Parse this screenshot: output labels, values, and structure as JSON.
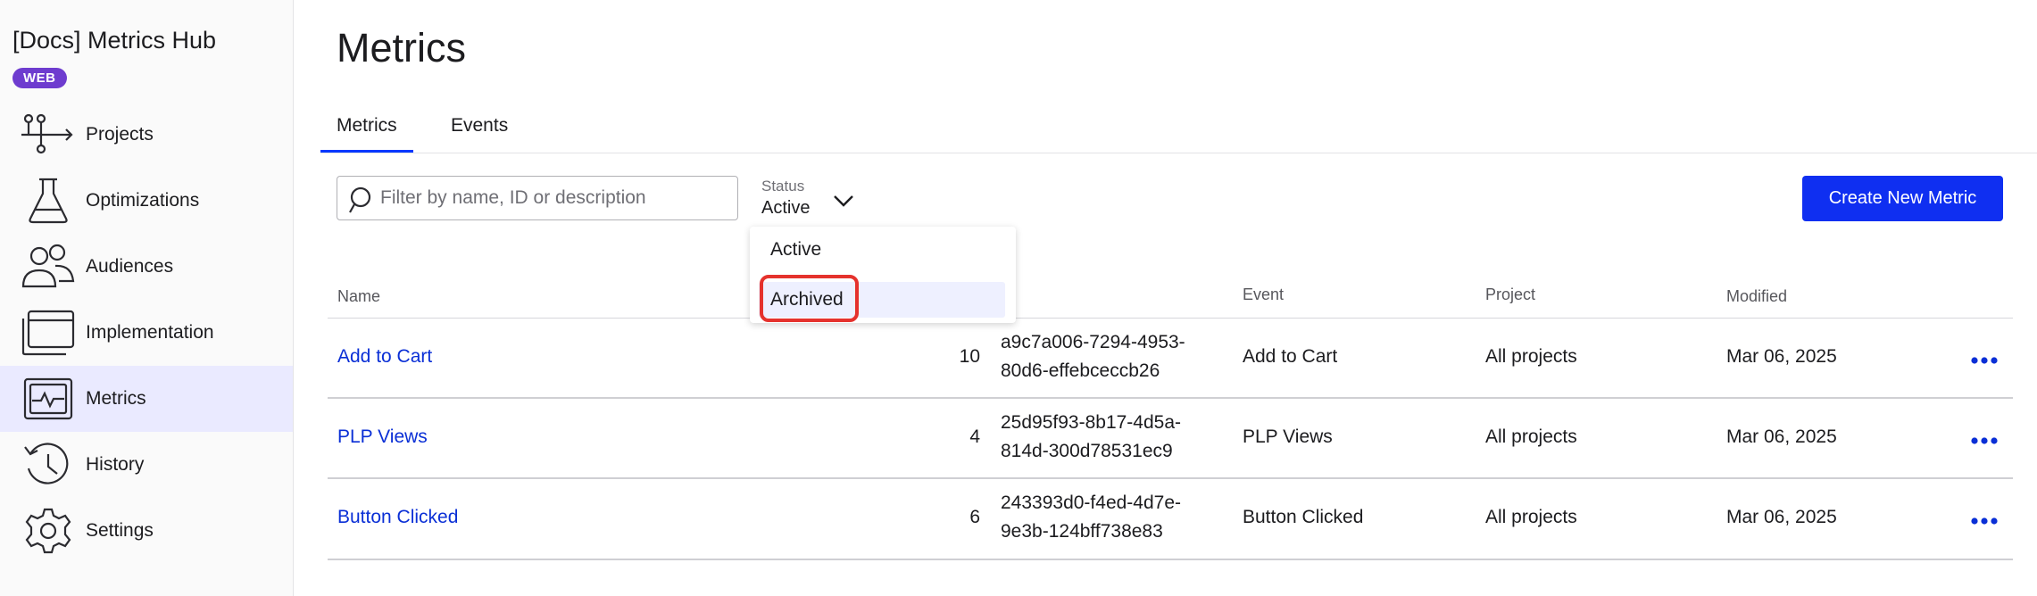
{
  "sidebar": {
    "app_title": "[Docs] Metrics Hub",
    "badge": "WEB",
    "items": [
      {
        "label": "Projects",
        "icon": "projects-icon"
      },
      {
        "label": "Optimizations",
        "icon": "flask-icon"
      },
      {
        "label": "Audiences",
        "icon": "users-icon"
      },
      {
        "label": "Implementation",
        "icon": "window-icon"
      },
      {
        "label": "Metrics",
        "icon": "pulse-chart-icon",
        "active": true
      },
      {
        "label": "History",
        "icon": "history-icon"
      },
      {
        "label": "Settings",
        "icon": "gear-icon"
      }
    ]
  },
  "main": {
    "title": "Metrics",
    "tabs": [
      {
        "label": "Metrics",
        "active": true
      },
      {
        "label": "Events",
        "active": false
      }
    ],
    "search": {
      "placeholder": "Filter by name, ID or description",
      "value": ""
    },
    "status": {
      "label": "Status",
      "value": "Active",
      "options": [
        "Active",
        "Archived"
      ],
      "highlighted": "Archived"
    },
    "create_button": "Create New Metric",
    "colors": {
      "accent": "#0f2ff1",
      "link": "#0a2fd6",
      "highlight_ring": "#e5322d",
      "active_nav": "#eaeaff"
    }
  },
  "table": {
    "headers": {
      "name": "Name",
      "event": "Event",
      "project": "Project",
      "modified": "Modified"
    },
    "rows": [
      {
        "name": "Add to Cart",
        "count": "10",
        "id_line1": "a9c7a006-7294-4953-",
        "id_line2": "80d6-effebceccb26",
        "event": "Add to Cart",
        "project": "All projects",
        "modified": "Mar 06, 2025"
      },
      {
        "name": "PLP Views",
        "count": "4",
        "id_line1": "25d95f93-8b17-4d5a-",
        "id_line2": "814d-300d78531ec9",
        "event": "PLP Views",
        "project": "All projects",
        "modified": "Mar 06, 2025"
      },
      {
        "name": "Button Clicked",
        "count": "6",
        "id_line1": "243393d0-f4ed-4d7e-",
        "id_line2": "9e3b-124bff738e83",
        "event": "Button Clicked",
        "project": "All projects",
        "modified": "Mar 06, 2025"
      }
    ]
  }
}
